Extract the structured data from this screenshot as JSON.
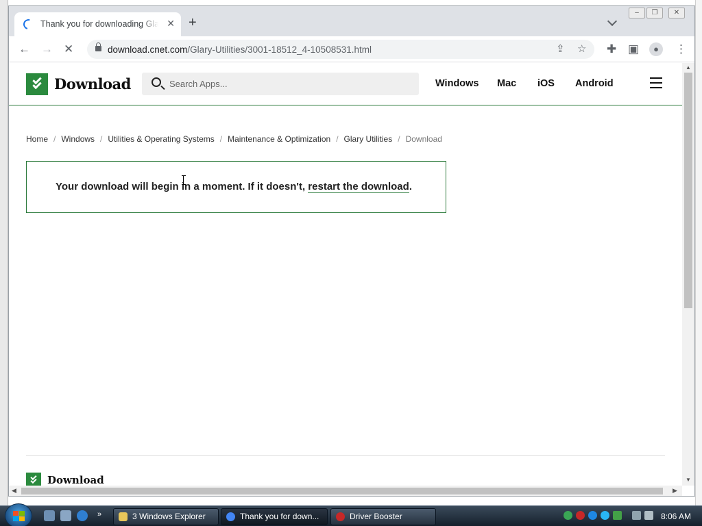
{
  "browser": {
    "tab_title": "Thank you for downloading Glary Utilities",
    "url_host": "download.cnet.com",
    "url_path": "/Glary-Utilities/3001-18512_4-10508531.html",
    "window_buttons": [
      "–",
      "❐",
      "✕"
    ]
  },
  "site": {
    "logo": "Download",
    "search_placeholder": "Search Apps...",
    "nav": [
      "Windows",
      "Mac",
      "iOS",
      "Android"
    ]
  },
  "breadcrumb": [
    "Home",
    "Windows",
    "Utilities & Operating Systems",
    "Maintenance & Optimization",
    "Glary Utilities"
  ],
  "breadcrumb_current": "Download",
  "message": {
    "text": "Your download will begin in a moment. If it doesn't,",
    "link": "restart the download",
    "end": "."
  },
  "footer": {
    "logo": "Download"
  },
  "taskbar": {
    "buttons": [
      "3 Windows Explorer",
      "Thank you for down...",
      "Driver Booster"
    ],
    "clock": "8:06 AM"
  },
  "colors": {
    "brand_green": "#2b8a3e",
    "spinner_blue": "#1a73e8"
  }
}
